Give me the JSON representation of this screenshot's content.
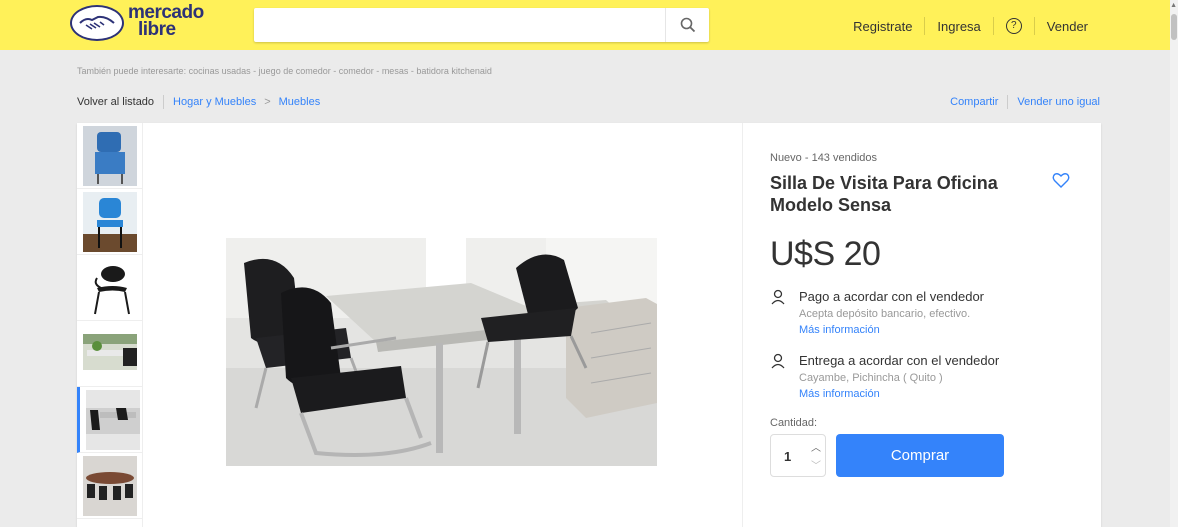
{
  "header": {
    "logo_line1": "mercado",
    "logo_line2": "libre",
    "search_value": "",
    "nav": {
      "register": "Registrate",
      "login": "Ingresa",
      "help": "?",
      "sell": "Vender"
    }
  },
  "suggestions": {
    "prefix": "También puede interesarte:",
    "items": [
      "cocinas usadas",
      "juego de comedor",
      "comedor",
      "mesas",
      "batidora kitchenaid"
    ],
    "separator": "-"
  },
  "breadcrumb": {
    "back": "Volver al listado",
    "cat1": "Hogar y Muebles",
    "chevron": ">",
    "cat2": "Muebles"
  },
  "actions": {
    "share": "Compartir",
    "sell_same": "Vender uno igual"
  },
  "product": {
    "condition": "Nuevo  -  143 vendidos",
    "title": "Silla De Visita Para Oficina Modelo Sensa",
    "price": "U$S 20",
    "payment": {
      "title": "Pago a acordar con el vendedor",
      "detail": "Acepta depósito bancario, efectivo.",
      "link": "Más información"
    },
    "delivery": {
      "title": "Entrega a acordar con el vendedor",
      "detail": "Cayambe, Pichincha ( Quito )",
      "link": "Más información"
    },
    "quantity_label": "Cantidad:",
    "quantity": "1",
    "buy_label": "Comprar"
  },
  "colors": {
    "header": "#fff159",
    "accent": "#3483fa",
    "brand_navy": "#2d3277"
  },
  "icons": [
    "handshake-logo-icon",
    "search-icon",
    "help-icon",
    "heart-icon",
    "person-icon",
    "chevron-up-icon",
    "chevron-down-icon"
  ]
}
